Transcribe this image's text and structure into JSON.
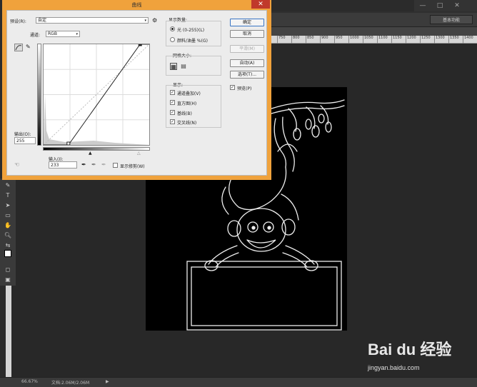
{
  "ps": {
    "window_controls": [
      "—",
      "□",
      "✕"
    ],
    "workspace": "基本功能",
    "ruler_ticks": [
      "750",
      "800",
      "850",
      "900",
      "950",
      "1000",
      "1050",
      "1100",
      "1150",
      "1200",
      "1250",
      "1300",
      "1350",
      "1400"
    ],
    "status": {
      "zoom": "66.67%",
      "doc": "文档:2.06M/2.06M"
    }
  },
  "dialog": {
    "title": "曲线",
    "preset_label": "预设(R):",
    "preset_value": "自定",
    "channel_label": "通道:",
    "channel_value": "RGB",
    "output_label": "输出(O):",
    "output_value": "255",
    "input_label": "输入(I):",
    "input_value": "233",
    "show_clipping_label": "显示修剪(W)",
    "display_amount_title": "显示数量:",
    "light_label": "光 (0-255)(L)",
    "pigment_label": "颜料/油墨 %(G)",
    "grid_size_title": "网格大小:",
    "show_title": "显示:",
    "show_options": [
      "通道叠加(V)",
      "直方图(H)",
      "基线(B)",
      "交叉线(N)"
    ],
    "buttons": {
      "ok": "确定",
      "cancel": "取消",
      "smooth": "平滑(M)",
      "auto": "自动(A)",
      "options": "选项(T)..."
    },
    "preview_label": "预览(P)",
    "curve": {
      "input_range": [
        0,
        255
      ],
      "points": [
        [
          0,
          0
        ],
        [
          233,
          255
        ]
      ]
    }
  },
  "brand": {
    "logo": "Bai du 经验",
    "url": "jingyan.baidu.com"
  }
}
